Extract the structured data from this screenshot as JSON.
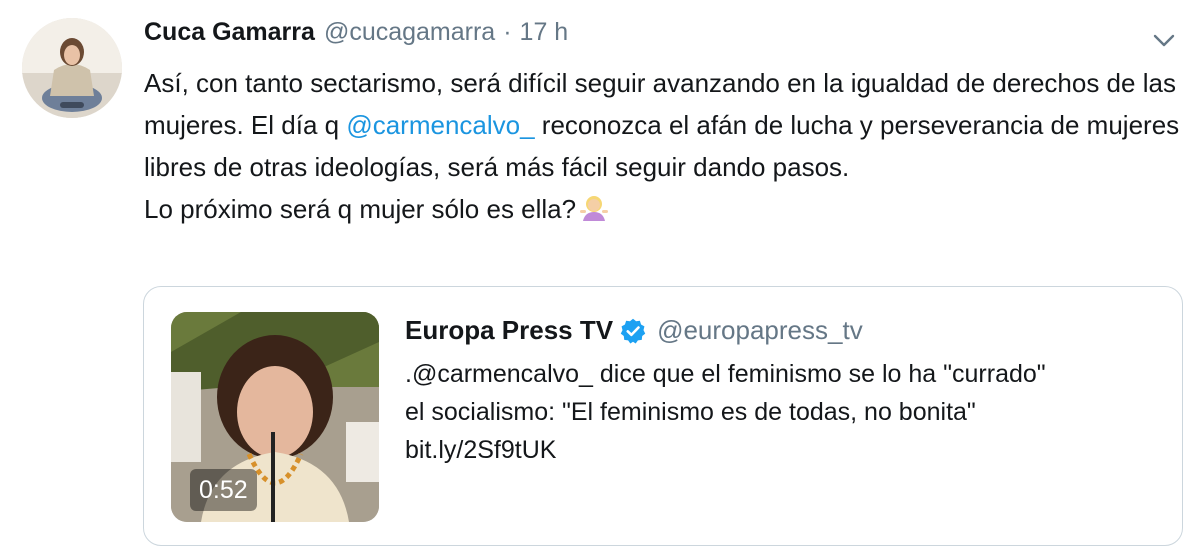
{
  "tweet": {
    "author_name": "Cuca Gamarra",
    "author_handle": "@cucagamarra",
    "separator": "·",
    "time": "17 h",
    "text_part1": "Así, con tanto sectarismo, será difícil seguir avanzando en la igualdad de derechos de las mujeres. El día q ",
    "mention": "@carmencalvo_",
    "text_part2": " reconozca el afán de lucha y perseverancia de mujeres libres de otras ideologías, será más fácil seguir dando pasos.",
    "text_line_last": "Lo próximo será q mujer sólo es ella?",
    "emoji": "woman-shrugging-emoji",
    "more_icon": "chevron-down-icon"
  },
  "quoted_tweet": {
    "author_name": "Europa Press TV",
    "verified_icon": "verified-badge-icon",
    "author_handle": "@europapress_tv",
    "text_line1": ".@carmencalvo_ dice que el feminismo se lo ha \"currado\"",
    "text_line2": "el socialismo: \"El feminismo es de todas, no bonita\"",
    "link": "bit.ly/2Sf9tUK",
    "video_duration": "0:52"
  },
  "colors": {
    "text": "#14171a",
    "secondary": "#657786",
    "link": "#1b95e0",
    "border": "#ccd6dd",
    "verified": "#1da1f2"
  }
}
